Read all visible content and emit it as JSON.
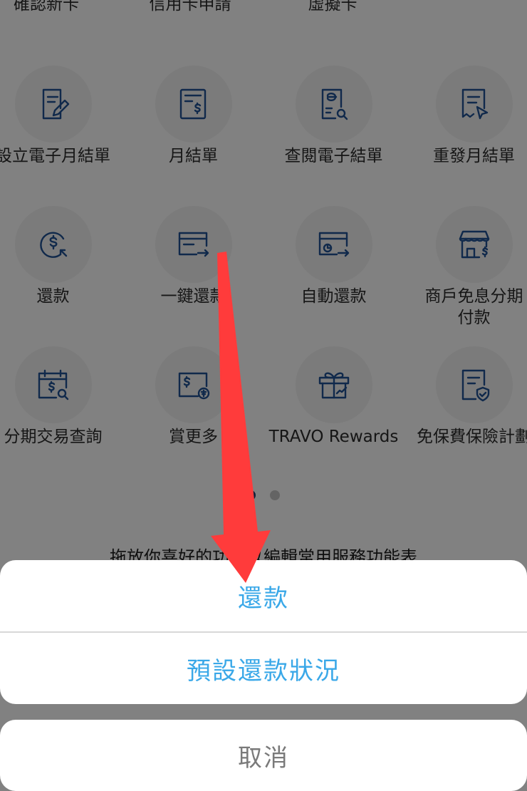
{
  "top_row": [
    "確認新卡",
    "信用卡申請",
    "虛擬卡"
  ],
  "grid": [
    {
      "label": "設立電子月結單",
      "icon": "edit-document-icon"
    },
    {
      "label": "月結單",
      "icon": "statement-dollar-icon"
    },
    {
      "label": "查閱電子結單",
      "icon": "e-statement-search-icon"
    },
    {
      "label": "重發月結單",
      "icon": "resend-statement-icon"
    },
    {
      "label": "還款",
      "icon": "repayment-dollar-icon"
    },
    {
      "label": "一鍵還款",
      "icon": "card-arrow-icon"
    },
    {
      "label": "自動還款",
      "icon": "card-clock-arrow-icon"
    },
    {
      "label": "商戶免息分期\n付款",
      "icon": "shop-dollar-icon"
    },
    {
      "label": "分期交易查詢",
      "icon": "calendar-dollar-search-icon"
    },
    {
      "label": "賞更多",
      "icon": "card-dollar-reward-icon"
    },
    {
      "label": "TRAVO Rewards",
      "icon": "gift-box-icon"
    },
    {
      "label": "免保費保險計劃",
      "icon": "document-shield-icon"
    }
  ],
  "pagination": {
    "pages": 2,
    "current": 1
  },
  "hint_text": "拖放你喜好的功能以編輯常用服務功能表",
  "action_sheet": {
    "options": [
      "還款",
      "預設還款狀況"
    ],
    "cancel": "取消"
  },
  "colors": {
    "icon_blue": "#1f4f8f",
    "sheet_option": "#3aa8e8",
    "cancel_text": "#7a7a7a",
    "arrow_red": "#ff3b3b",
    "dot_active": "#1f3f6f",
    "dot_inactive": "#bdbdbd"
  }
}
